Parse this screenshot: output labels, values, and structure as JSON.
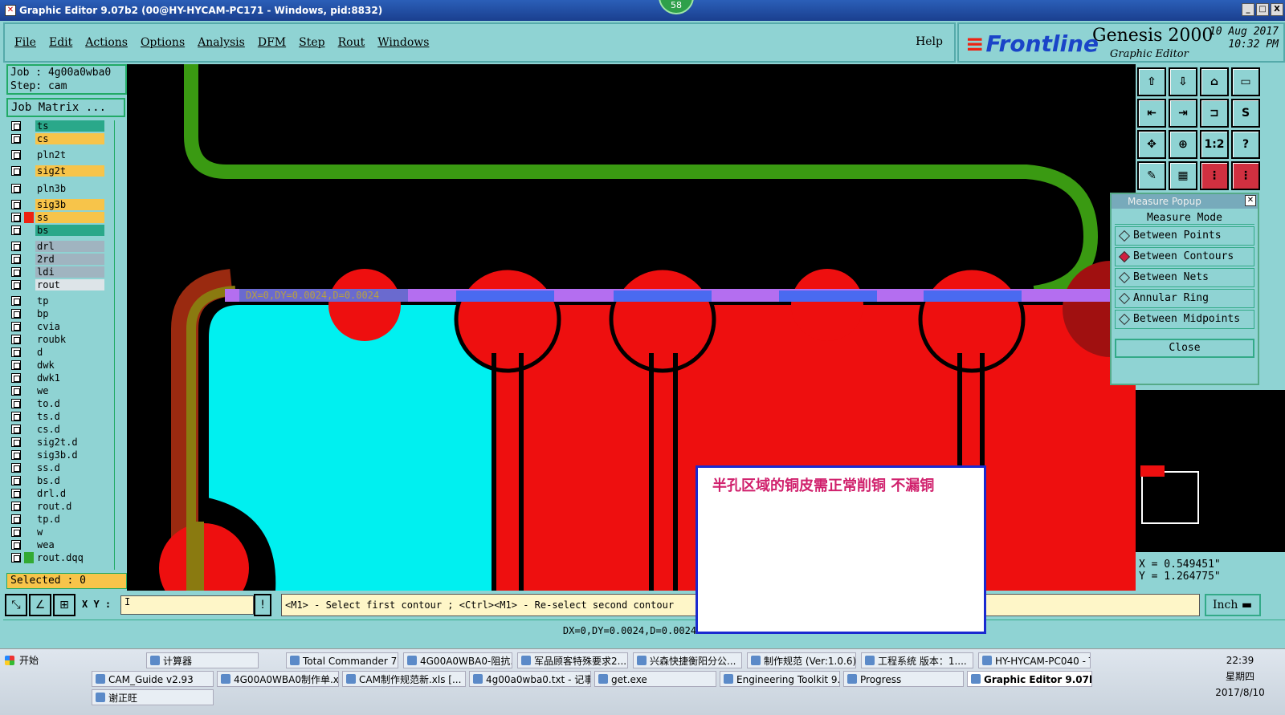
{
  "window": {
    "title": "Graphic Editor 9.07b2 (00@HY-HYCAM-PC171 - Windows, pid:8832)",
    "badge": "58",
    "buttons": [
      "_",
      "□",
      "X"
    ]
  },
  "menu": {
    "items": [
      "File",
      "Edit",
      "Actions",
      "Options",
      "Analysis",
      "DFM",
      "Step",
      "Rout",
      "Windows"
    ],
    "help": "Help"
  },
  "brand": {
    "logo": "Frontline",
    "product": "Genesis 2000",
    "subtitle": "Graphic Editor",
    "date": "10 Aug 2017",
    "time": "10:32 PM"
  },
  "job": {
    "job_line": "Job : 4g00a0wba0",
    "step_line": "Step: cam",
    "matrix_button": "Job Matrix ...",
    "selected": "Selected : 0"
  },
  "layers": [
    {
      "name": "ts",
      "color": "#2aa88a"
    },
    {
      "name": "cs",
      "color": "#f7c44a"
    },
    {
      "name": "pln2t",
      "color": "#8fd3d3"
    },
    {
      "name": "sig2t",
      "color": "#f7c44a"
    },
    {
      "name": "pln3b",
      "color": "#8fd3d3"
    },
    {
      "name": "sig3b",
      "color": "#f7c44a"
    },
    {
      "name": "ss",
      "color": "#f7c44a",
      "mark": "#e21"
    },
    {
      "name": "bs",
      "color": "#2aa88a"
    },
    {
      "name": "drl",
      "color": "#a0b4c0"
    },
    {
      "name": "2rd",
      "color": "#a0b4c0"
    },
    {
      "name": "ldi",
      "color": "#a0b4c0"
    },
    {
      "name": "rout",
      "color": "#dde4e8"
    },
    {
      "name": "tp",
      "color": "#8fd3d3"
    },
    {
      "name": "bp",
      "color": "#8fd3d3"
    },
    {
      "name": "cvia",
      "color": "#8fd3d3"
    },
    {
      "name": "roubk",
      "color": "#8fd3d3"
    },
    {
      "name": "d",
      "color": "#8fd3d3"
    },
    {
      "name": "dwk",
      "color": "#8fd3d3"
    },
    {
      "name": "dwk1",
      "color": "#8fd3d3"
    },
    {
      "name": "we",
      "color": "#8fd3d3"
    },
    {
      "name": "to.d",
      "color": "#8fd3d3"
    },
    {
      "name": "ts.d",
      "color": "#8fd3d3"
    },
    {
      "name": "cs.d",
      "color": "#8fd3d3"
    },
    {
      "name": "sig2t.d",
      "color": "#8fd3d3"
    },
    {
      "name": "sig3b.d",
      "color": "#8fd3d3"
    },
    {
      "name": "ss.d",
      "color": "#8fd3d3"
    },
    {
      "name": "bs.d",
      "color": "#8fd3d3"
    },
    {
      "name": "drl.d",
      "color": "#8fd3d3"
    },
    {
      "name": "rout.d",
      "color": "#8fd3d3"
    },
    {
      "name": "tp.d",
      "color": "#8fd3d3"
    },
    {
      "name": "w",
      "color": "#8fd3d3"
    },
    {
      "name": "wea",
      "color": "#8fd3d3"
    },
    {
      "name": "rout.dqq",
      "color": "#8fd3d3",
      "mark": "#3a3"
    }
  ],
  "canvas": {
    "measure_label": "DX=0,DY=0.0024,D=0.0024",
    "annotation": "半孔区域的铜皮需正常削铜 不漏铜"
  },
  "tools": [
    "⇧",
    "⇩",
    "⌂",
    "▭",
    "⇤",
    "⇥",
    "⊐",
    "S",
    "✥",
    "⊕",
    "1:2",
    "?",
    "✎",
    "▦",
    "⋮",
    "⋮"
  ],
  "measure_popup": {
    "title": "Measure Popup",
    "mode_label": "Measure Mode",
    "options": [
      "Between Points",
      "Between Contours",
      "Between Nets",
      "Annular Ring",
      "Between Midpoints"
    ],
    "active_option": "Between Contours",
    "close": "Close"
  },
  "coords": {
    "x": "X = 0.549451\"",
    "y": "Y = 1.264775\""
  },
  "bottom": {
    "xy_label": "X Y :",
    "xy_value": "I",
    "prompt": "<M1> - Select first contour ; <Ctrl><M1> - Re-select second contour",
    "unit": "Inch",
    "status": "DX=0,DY=0.0024,D=0.0024"
  },
  "taskbar": {
    "start": "开始",
    "row1": [
      "计算器",
      "Total Commander 7.0...",
      "4G00A0WBA0-阻抗...",
      "军品顾客特殊要求2...",
      "兴森快捷衡阳分公...",
      "制作规范 (Ver:1.0.6)",
      "工程系统   版本：1....",
      "HY-HYCAM-PC040 - T..."
    ],
    "row2": [
      "CAM_Guide v2.93",
      "4G00A0WBA0制作单.xl...",
      "CAM制作规范新.xls [...",
      "4g00a0wba0.txt - 记事本",
      "get.exe",
      "Engineering Toolkit 9.07...",
      "Progress",
      "Graphic Editor 9.07b2..."
    ],
    "row3": [
      "谢正旺"
    ],
    "time": "22:39",
    "weekday": "星期四",
    "date": "2017/8/10"
  }
}
